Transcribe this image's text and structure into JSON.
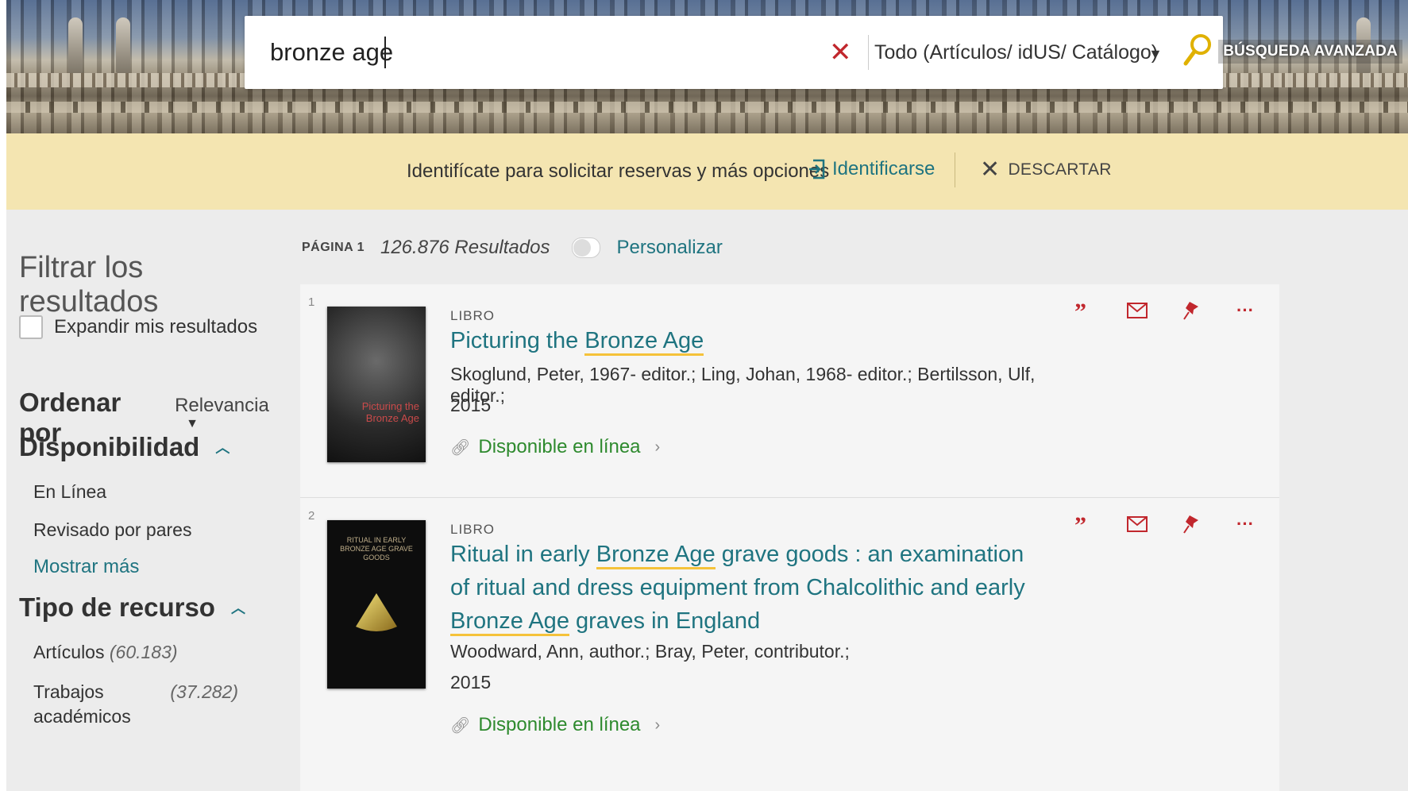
{
  "search": {
    "query": "bronze age",
    "scope": "Todo (Artículos/ idUS/ Catálogo)",
    "advanced_label": "BÚSQUEDA AVANZADA"
  },
  "notice": {
    "text": "Identifícate para solicitar reservas y más opciones",
    "login_label": "Identificarse",
    "dismiss_label": "DESCARTAR"
  },
  "sidebar": {
    "filter_title": "Filtrar los resultados",
    "expand_label": "Expandir mis resultados",
    "sort_label": "Ordenar por",
    "sort_value": "Relevancia",
    "availability": {
      "title": "Disponibilidad",
      "items": [
        "En Línea",
        "Revisado por pares"
      ],
      "more_label": "Mostrar más"
    },
    "resource_type": {
      "title": "Tipo de recurso",
      "items": [
        {
          "label": "Artículos",
          "count": "(60.183)"
        },
        {
          "label": "Trabajos académicos",
          "count": "(37.282)"
        }
      ]
    }
  },
  "results_header": {
    "page_label": "PÁGINA 1",
    "count_text": "126.876 Resultados",
    "customize_label": "Personalizar"
  },
  "results": [
    {
      "number": "1",
      "type": "LIBRO",
      "title_parts": [
        "Picturing the ",
        "Bronze Age"
      ],
      "authors": "Skoglund, Peter, 1967- editor.; Ling, Johan, 1968- editor.; Bertilsson, Ulf, editor.;",
      "year": "2015",
      "availability": "Disponible en línea",
      "cover_text": "Picturing the Bronze Age"
    },
    {
      "number": "2",
      "type": "LIBRO",
      "title_parts": [
        "Ritual in early ",
        "Bronze Age",
        " grave goods : an examination of ritual and dress equipment from Chalcolithic and early ",
        "Bronze Age",
        " graves in England"
      ],
      "authors": "Woodward, Ann, author.; Bray, Peter, contributor.;",
      "year": "2015",
      "availability": "Disponible en línea",
      "cover_text": "RITUAL IN EARLY BRONZE AGE GRAVE GOODS"
    }
  ],
  "icons": {
    "clear": "close-icon",
    "search": "magnifier-icon",
    "login": "login-icon",
    "cite": "quote-icon",
    "email": "envelope-icon",
    "pin": "pin-icon",
    "more": "ellipsis-icon",
    "link": "link-icon"
  },
  "colors": {
    "accent": "#1f7480",
    "available": "#2e8a2e",
    "action_red": "#c1272d",
    "highlight": "#f5c23a",
    "notice_bg": "#f4e5b1"
  }
}
